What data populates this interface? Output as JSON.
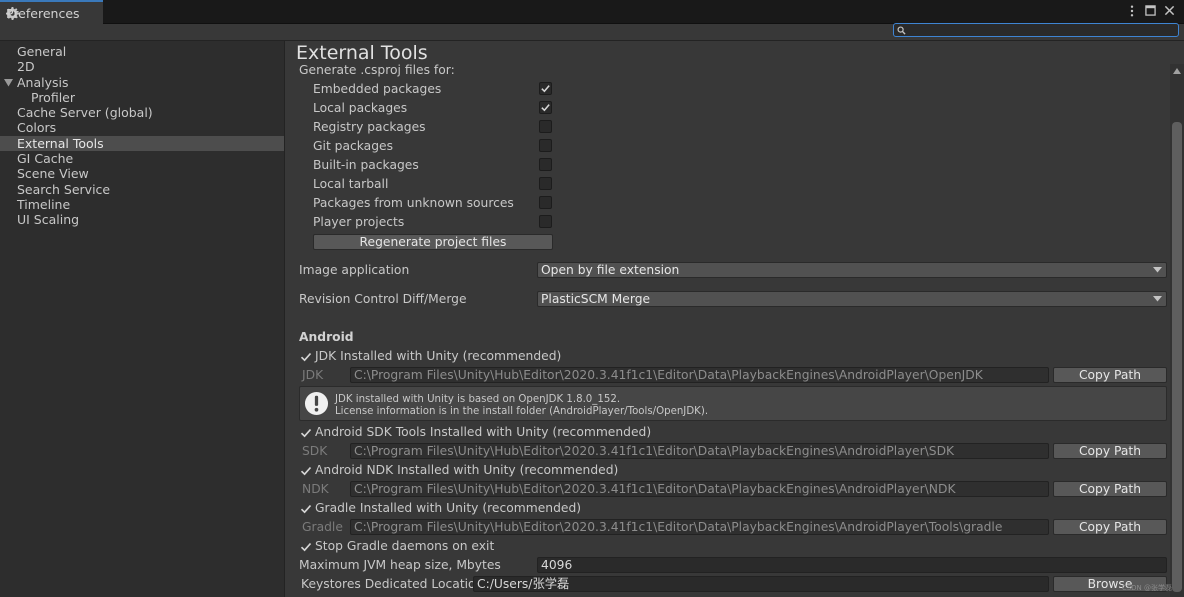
{
  "window": {
    "tab_title": "Preferences"
  },
  "search": {
    "value": ""
  },
  "sidebar": {
    "items": [
      {
        "label": "General"
      },
      {
        "label": "2D"
      },
      {
        "label": "Analysis"
      },
      {
        "label": "Profiler"
      },
      {
        "label": "Cache Server (global)"
      },
      {
        "label": "Colors"
      },
      {
        "label": "External Tools"
      },
      {
        "label": "GI Cache"
      },
      {
        "label": "Scene View"
      },
      {
        "label": "Search Service"
      },
      {
        "label": "Timeline"
      },
      {
        "label": "UI Scaling"
      }
    ],
    "selected": "External Tools"
  },
  "main": {
    "title": "External Tools",
    "csproj": {
      "heading": "Generate .csproj files for:",
      "options": [
        {
          "label": "Embedded packages",
          "checked": true
        },
        {
          "label": "Local packages",
          "checked": true
        },
        {
          "label": "Registry packages",
          "checked": false
        },
        {
          "label": "Git packages",
          "checked": false
        },
        {
          "label": "Built-in packages",
          "checked": false
        },
        {
          "label": "Local tarball",
          "checked": false
        },
        {
          "label": "Packages from unknown sources",
          "checked": false
        },
        {
          "label": "Player projects",
          "checked": false
        }
      ],
      "regenerate_label": "Regenerate project files"
    },
    "image_application": {
      "label": "Image application",
      "value": "Open by file extension"
    },
    "revision_control": {
      "label": "Revision Control Diff/Merge",
      "value": "PlasticSCM Merge"
    },
    "android": {
      "heading": "Android",
      "jdk": {
        "toggle_label": "JDK Installed with Unity (recommended)",
        "prefix": "JDK",
        "path": "C:\\Program Files\\Unity\\Hub\\Editor\\2020.3.41f1c1\\Editor\\Data\\PlaybackEngines\\AndroidPlayer\\OpenJDK",
        "copy_label": "Copy Path"
      },
      "jdk_info": {
        "line1": "JDK installed with Unity is based on OpenJDK 1.8.0_152.",
        "line2": "License information is in the install folder (AndroidPlayer/Tools/OpenJDK)."
      },
      "sdk": {
        "toggle_label": "Android SDK Tools Installed with Unity (recommended)",
        "prefix": "SDK",
        "path": "C:\\Program Files\\Unity\\Hub\\Editor\\2020.3.41f1c1\\Editor\\Data\\PlaybackEngines\\AndroidPlayer\\SDK",
        "copy_label": "Copy Path"
      },
      "ndk": {
        "toggle_label": "Android NDK Installed with Unity (recommended)",
        "prefix": "NDK",
        "path": "C:\\Program Files\\Unity\\Hub\\Editor\\2020.3.41f1c1\\Editor\\Data\\PlaybackEngines\\AndroidPlayer\\NDK",
        "copy_label": "Copy Path"
      },
      "gradle": {
        "toggle_label": "Gradle Installed with Unity (recommended)",
        "prefix": "Gradle",
        "path": "C:\\Program Files\\Unity\\Hub\\Editor\\2020.3.41f1c1\\Editor\\Data\\PlaybackEngines\\AndroidPlayer\\Tools\\gradle",
        "copy_label": "Copy Path"
      },
      "stop_gradle": {
        "label": "Stop Gradle daemons on exit"
      },
      "jvm_heap": {
        "label": "Maximum JVM heap size, Mbytes",
        "value": "4096"
      },
      "keystores": {
        "label": "Keystores Dedicated Location",
        "value": "C:/Users/张学磊",
        "browse_label": "Browse"
      }
    }
  },
  "watermark": "CSDN @张学磊"
}
